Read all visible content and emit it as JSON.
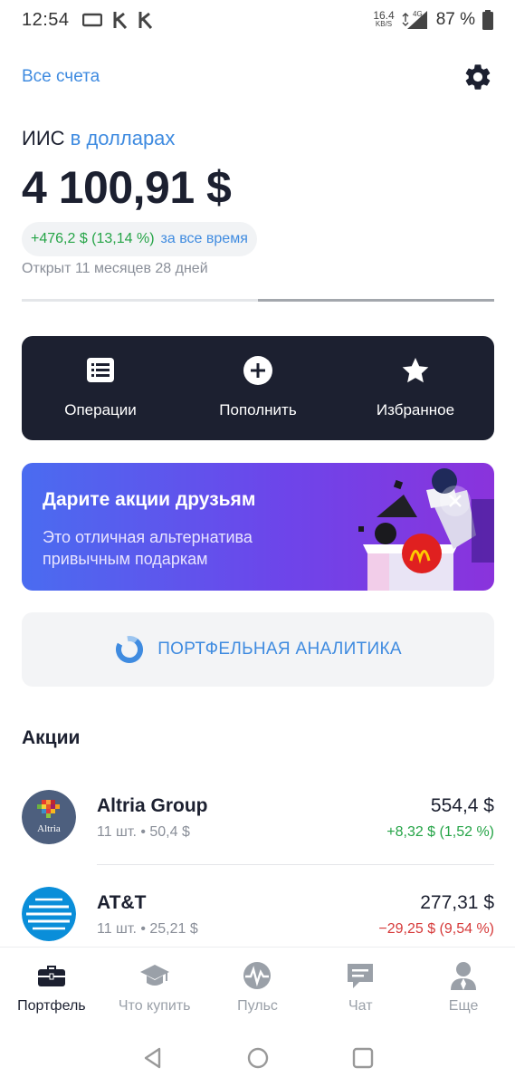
{
  "status_bar": {
    "time": "12:54",
    "net_speed_value": "16.4",
    "net_speed_unit": "KB/S",
    "network_type": "4G",
    "battery": "87 %"
  },
  "header": {
    "all_accounts_label": "Все счета",
    "settings_icon": "gear-icon"
  },
  "account": {
    "type": "ИИС",
    "currency_label": "в долларах",
    "balance": "4 100,91 $",
    "profit": "+476,2 $ (13,14 %)",
    "profit_period": "за все время",
    "opened": "Открыт 11 месяцев 28 дней",
    "carousel_position_fraction": 0.5
  },
  "actions": [
    {
      "label": "Операции",
      "icon": "list-icon"
    },
    {
      "label": "Пополнить",
      "icon": "plus-circle-icon"
    },
    {
      "label": "Избранное",
      "icon": "star-icon"
    }
  ],
  "promo": {
    "title": "Дарите акции друзьям",
    "text": "Это отличная альтернатива привычным подаркам"
  },
  "analytics": {
    "label": "ПОРТФЕЛЬНАЯ АНАЛИТИКА",
    "icon": "donut-chart-icon"
  },
  "stocks_section": {
    "title": "Акции",
    "items": [
      {
        "name": "Altria Group",
        "logo_text": "Altria",
        "details": "11 шт. • 50,4 $",
        "price": "554,4 $",
        "change": "+8,32 $ (1,52 %)",
        "direction": "up"
      },
      {
        "name": "AT&T",
        "logo_text": "",
        "details": "11 шт. • 25,21 $",
        "price": "277,31 $",
        "change": "−29,25 $ (9,54 %)",
        "direction": "down"
      }
    ]
  },
  "bottom_nav": [
    {
      "label": "Портфель",
      "icon": "briefcase-icon",
      "active": true
    },
    {
      "label": "Что купить",
      "icon": "graduation-cap-icon",
      "active": false
    },
    {
      "label": "Пульс",
      "icon": "pulse-icon",
      "active": false
    },
    {
      "label": "Чат",
      "icon": "chat-icon",
      "active": false
    },
    {
      "label": "Еще",
      "icon": "user-icon",
      "active": false
    }
  ],
  "colors": {
    "accent": "#3f8be0",
    "dark": "#1c2030",
    "positive": "#25a447",
    "negative": "#d63a3a"
  }
}
